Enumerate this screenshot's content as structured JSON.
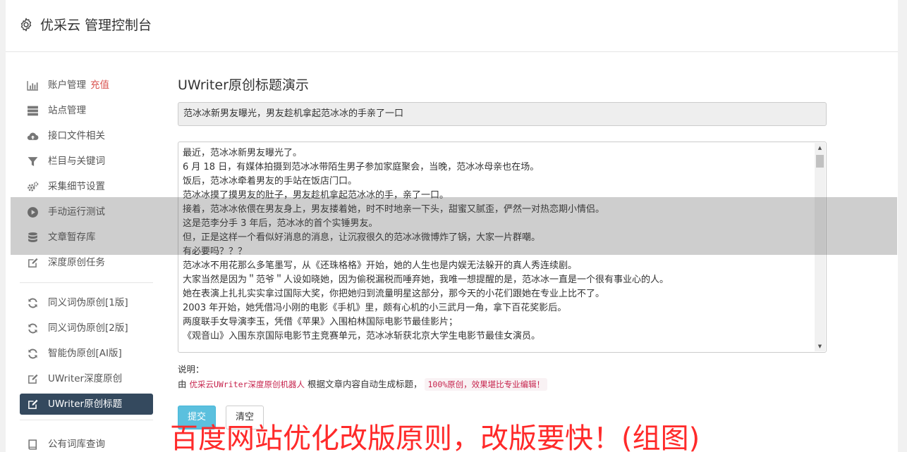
{
  "header": {
    "title": "优采云 管理控制台",
    "icon": "gear-icon"
  },
  "sidebar": {
    "items": [
      {
        "label": "账户管理",
        "badge": "充值",
        "icon": "bar-chart-icon"
      },
      {
        "label": "站点管理",
        "icon": "server-icon"
      },
      {
        "label": "接口文件相关",
        "icon": "cloud-upload-icon"
      },
      {
        "label": "栏目与关键词",
        "icon": "filter-icon"
      },
      {
        "label": "采集细节设置",
        "icon": "cogs-icon"
      },
      {
        "label": "手动运行测试",
        "icon": "play-circle-icon"
      },
      {
        "label": "文章暂存库",
        "icon": "database-icon"
      },
      {
        "label": "深度原创任务",
        "icon": "edit-icon"
      },
      {
        "label": "同义词伪原创[1版]",
        "icon": "refresh-icon"
      },
      {
        "label": "同义词伪原创[2版]",
        "icon": "refresh-icon"
      },
      {
        "label": "智能伪原创[AI版]",
        "icon": "refresh-icon"
      },
      {
        "label": "UWriter深度原创",
        "icon": "edit-icon"
      },
      {
        "label": "UWriter原创标题",
        "icon": "edit-icon",
        "active": true
      },
      {
        "label": "公有词库查询",
        "icon": "book-icon"
      }
    ]
  },
  "main": {
    "title": "UWriter原创标题演示",
    "title_value": "范冰冰新男友曝光，男友趁机拿起范冰冰的手亲了一口",
    "content_lines": [
      "最近，范冰冰新男友曝光了。",
      "6 月 18 日，有媒体拍摄到范冰冰带陌生男子参加家庭聚会，当晚，范冰冰母亲也在场。",
      "饭后，范冰冰牵着男友的手站在饭店门口。",
      "范冰冰摸了摸男友的肚子，男友趁机拿起范冰冰的手，亲了一口。",
      "接着，范冰冰依偎在男友身上，男友搂着她，时不时地亲一下头，甜蜜又腻歪，俨然一对热恋期小情侣。",
      "这是范李分手 3 年后，范冰冰的首个实锤男友。",
      "但，正是这样一个看似好消息的消息，让沉寂很久的范冰冰微博炸了锅，大家一片群嘲。",
      "有必要吗？？？",
      "范冰冰不用花那么多笔墨写，从《还珠格格》开始，她的人生也是内娱无法躲开的真人秀连续剧。",
      "大家当然是因为＂范爷＂人设如晓她，因为偷税漏税而唾弃她，我唯一想提醒的是，范冰冰一直是一个很有事业心的人。",
      "她在表演上扎扎实实拿过国际大奖，你把她归到流量明星这部分，那今天的小花们跟她在专业上比不了。",
      "2003 年开始，她凭借冯小刚的电影《手机》里，颇有心机的小三武月一角，拿下百花奖影后。",
      "两度联手女导演李玉，凭借《苹果》入围柏林国际电影节最佳影片；",
      "《观音山》入围东京国际电影节主竞赛单元，范冰冰斩获北京大学生电影节最佳女演员。"
    ],
    "note_label": "说明：",
    "note_prefix": "由",
    "note_code": "优采云UWriter深度原创机器人",
    "note_middle": "根据文章内容自动生成标题，",
    "note_highlight": "100%原创，效果堪比专业编辑！",
    "submit_label": "提交",
    "clear_label": "清空"
  },
  "watermark": "百度网站优化改版原则，改版要快！(组图)",
  "colors": {
    "active_nav": "#34495e",
    "submit": "#5bc0de",
    "badge": "#d9534f",
    "watermark": "#ff2a2a"
  }
}
